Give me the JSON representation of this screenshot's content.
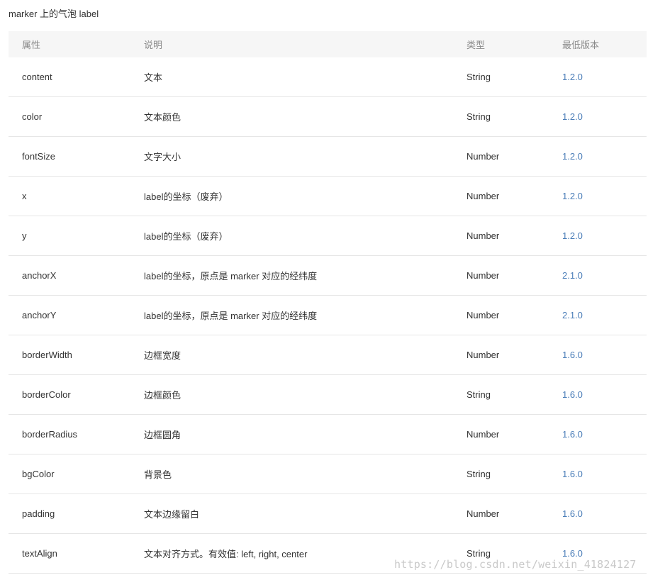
{
  "caption": "marker 上的气泡 label",
  "table": {
    "headers": {
      "property": "属性",
      "description": "说明",
      "type": "类型",
      "min_version": "最低版本"
    },
    "rows": [
      {
        "property": "content",
        "description": "文本",
        "type": "String",
        "min_version": "1.2.0"
      },
      {
        "property": "color",
        "description": "文本颜色",
        "type": "String",
        "min_version": "1.2.0"
      },
      {
        "property": "fontSize",
        "description": "文字大小",
        "type": "Number",
        "min_version": "1.2.0"
      },
      {
        "property": "x",
        "description": "label的坐标（废弃）",
        "type": "Number",
        "min_version": "1.2.0"
      },
      {
        "property": "y",
        "description": "label的坐标（废弃）",
        "type": "Number",
        "min_version": "1.2.0"
      },
      {
        "property": "anchorX",
        "description": "label的坐标，原点是 marker 对应的经纬度",
        "type": "Number",
        "min_version": "2.1.0"
      },
      {
        "property": "anchorY",
        "description": "label的坐标，原点是 marker 对应的经纬度",
        "type": "Number",
        "min_version": "2.1.0"
      },
      {
        "property": "borderWidth",
        "description": "边框宽度",
        "type": "Number",
        "min_version": "1.6.0"
      },
      {
        "property": "borderColor",
        "description": "边框颜色",
        "type": "String",
        "min_version": "1.6.0"
      },
      {
        "property": "borderRadius",
        "description": "边框圆角",
        "type": "Number",
        "min_version": "1.6.0"
      },
      {
        "property": "bgColor",
        "description": "背景色",
        "type": "String",
        "min_version": "1.6.0"
      },
      {
        "property": "padding",
        "description": "文本边缘留白",
        "type": "Number",
        "min_version": "1.6.0"
      },
      {
        "property": "textAlign",
        "description": "文本对齐方式。有效值: left, right, center",
        "type": "String",
        "min_version": "1.6.0"
      }
    ]
  },
  "watermark": "https://blog.csdn.net/weixin_41824127",
  "colors": {
    "header_bg": "#f6f6f6",
    "version_link": "#4a7db8",
    "divider": "#e6e6e6"
  }
}
